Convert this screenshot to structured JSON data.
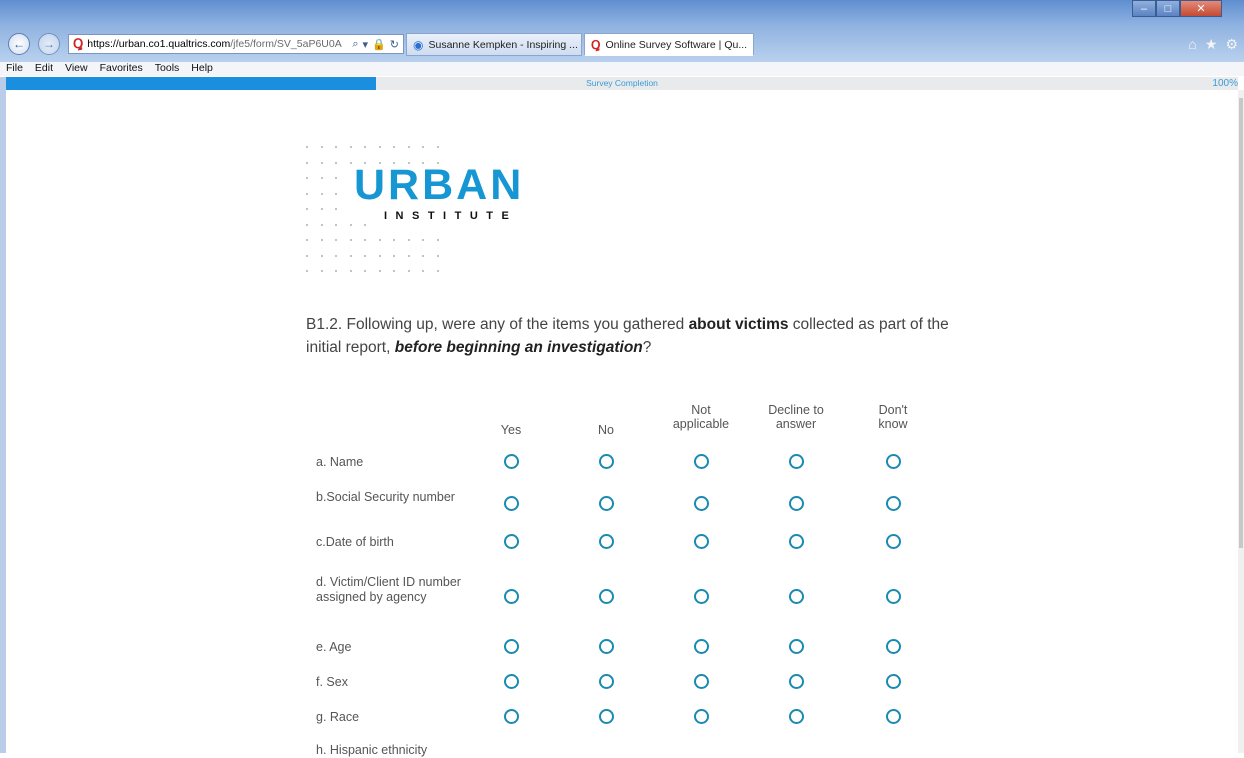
{
  "browser": {
    "url_host": "https://urban.co1.qualtrics.com",
    "url_path": "/jfe5/form/SV_5aP6U0A",
    "tabs": [
      {
        "title": "Susanne Kempken - Inspiring ..."
      },
      {
        "title": "Online Survey Software | Qu..."
      }
    ],
    "menu": [
      "File",
      "Edit",
      "View",
      "Favorites",
      "Tools",
      "Help"
    ]
  },
  "progress": {
    "label": "Survey Completion",
    "percent_text": "100%",
    "fill_fraction": 0.3
  },
  "logo": {
    "word1": "URBAN",
    "word2": "INSTITUTE"
  },
  "question": {
    "prefix": "B1.2. Following up, were any of the items you gathered ",
    "bold": "about victims",
    "middle": " collected as part of the initial report, ",
    "bold_italic": "before beginning an investigation",
    "suffix": "?"
  },
  "matrix": {
    "columns": [
      "Yes",
      "No",
      "Not applicable",
      "Decline to answer",
      "Don't know"
    ],
    "rows": [
      "a. Name",
      "b.Social Security number",
      "c.Date of birth",
      "d. Victim/Client ID number assigned by agency",
      "e. Age",
      "f. Sex",
      "g. Race",
      "h. Hispanic ethnicity"
    ]
  },
  "colors": {
    "accent": "#1696d2",
    "radio": "#1a8ab0"
  }
}
